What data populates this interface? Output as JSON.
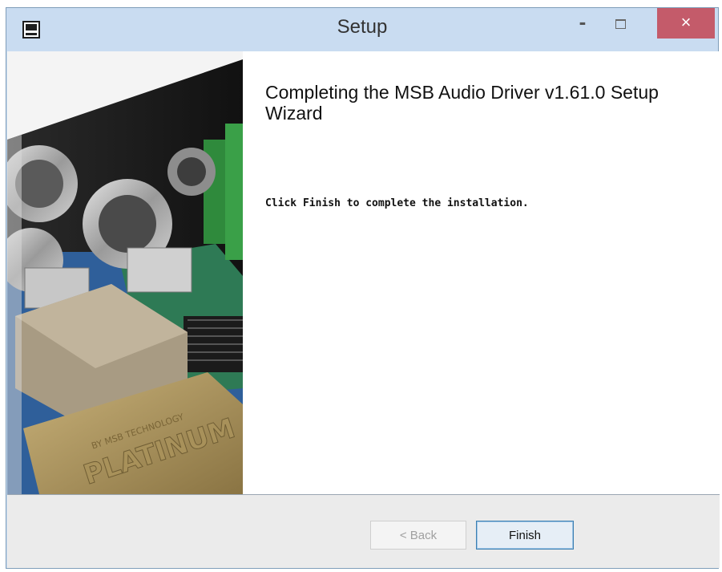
{
  "window": {
    "title": "Setup",
    "minimize_label": "-",
    "close_label": "×"
  },
  "wizard": {
    "heading": "Completing the MSB Audio Driver v1.61.0 Setup Wizard",
    "body": "Click Finish to complete the installation.",
    "image_text": "PLATINUM",
    "image_subtext": "BY MSB TECHNOLOGY"
  },
  "buttons": {
    "back_label": "< Back",
    "finish_label": "Finish"
  }
}
